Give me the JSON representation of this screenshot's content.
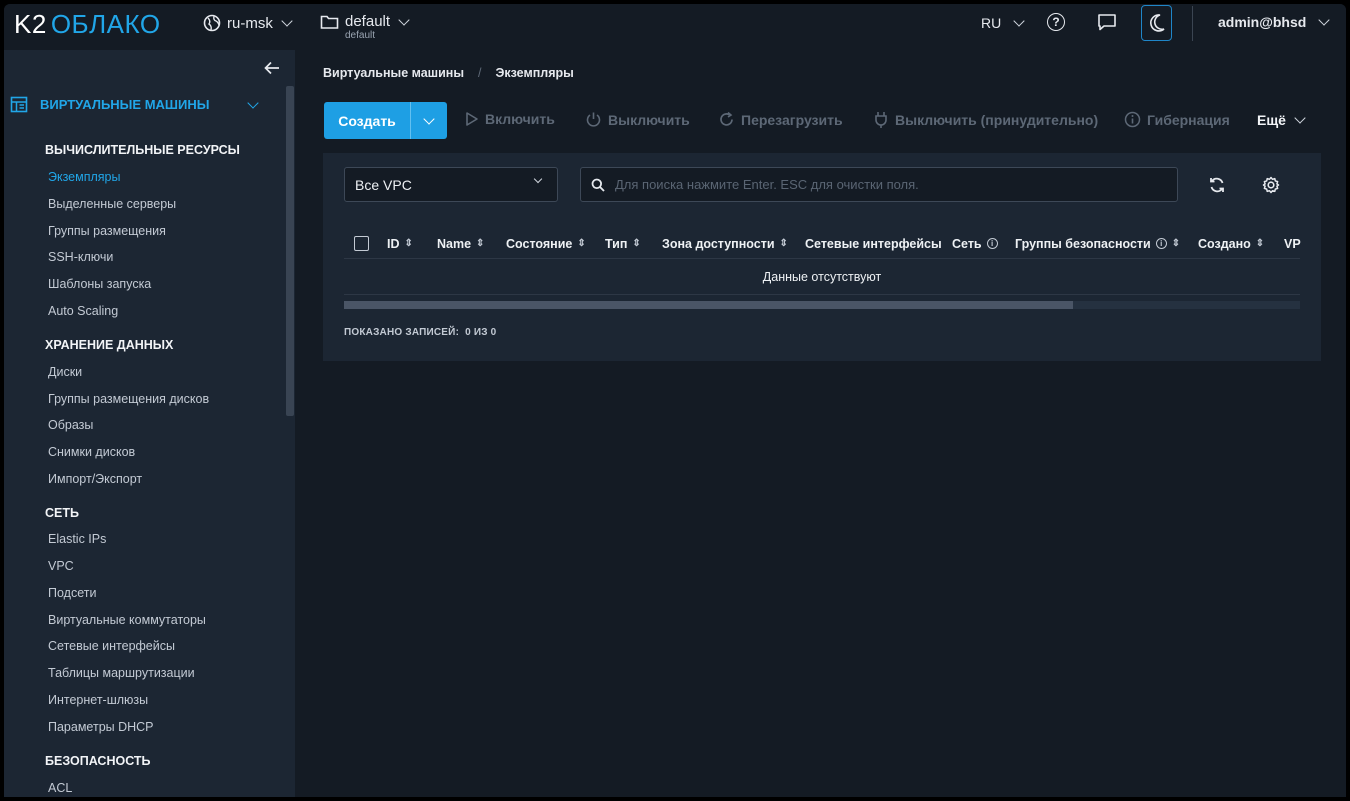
{
  "header": {
    "logo_k2": "K2",
    "logo_cloud": "ОБЛАКО",
    "region": "ru-msk",
    "project": "default",
    "project_sub": "default",
    "language": "RU",
    "user": "admin@bhsd",
    "icons": [
      "globe-icon",
      "folder-icon",
      "help-icon",
      "chat-icon",
      "moon-icon"
    ]
  },
  "sidebar": {
    "section_title": "ВИРТУАЛЬНЫЕ МАШИНЫ",
    "groups": [
      {
        "title": "ВЫЧИСЛИТЕЛЬНЫЕ РЕСУРСЫ",
        "items": [
          "Экземпляры",
          "Выделенные серверы",
          "Группы размещения",
          "SSH-ключи",
          "Шаблоны запуска",
          "Auto Scaling"
        ]
      },
      {
        "title": "ХРАНЕНИЕ ДАННЫХ",
        "items": [
          "Диски",
          "Группы размещения дисков",
          "Образы",
          "Снимки дисков",
          "Импорт/Экспорт"
        ]
      },
      {
        "title": "СЕТЬ",
        "items": [
          "Elastic IPs",
          "VPC",
          "Подсети",
          "Виртуальные коммутаторы",
          "Сетевые интерфейсы",
          "Таблицы маршрутизации",
          "Интернет-шлюзы",
          "Параметры DHCP"
        ]
      },
      {
        "title": "БЕЗОПАСНОСТЬ",
        "items": [
          "ACL"
        ]
      }
    ],
    "active_item": "Экземпляры"
  },
  "breadcrumb": {
    "parent": "Виртуальные машины",
    "separator": "/",
    "current": "Экземпляры"
  },
  "toolbar": {
    "create_label": "Создать",
    "actions": [
      "Включить",
      "Выключить",
      "Перезагрузить",
      "Выключить (принудительно)",
      "Гибернация"
    ],
    "more_label": "Ещё"
  },
  "filters": {
    "vpc_selected": "Все VPC",
    "search_placeholder": "Для поиска нажмите Enter. ESC для очистки поля."
  },
  "table": {
    "columns": [
      "ID",
      "Name",
      "Состояние",
      "Тип",
      "Зона доступности",
      "Сетевые интерфейсы",
      "Сеть",
      "Группы безопасности",
      "Создано",
      "VP"
    ],
    "empty_text": "Данные отсутствуют",
    "shown_label": "ПОКАЗАНО ЗАПИСЕЙ:",
    "shown_value": "0 ИЗ 0"
  }
}
